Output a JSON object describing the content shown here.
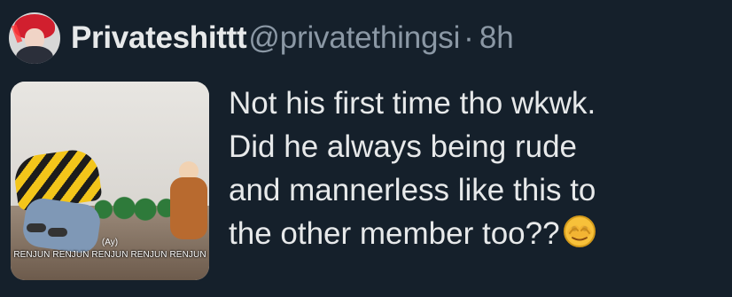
{
  "user": {
    "display_name": "Privateshittt",
    "handle": "@privatethingsi",
    "separator": "·",
    "time": "8h"
  },
  "media": {
    "caption_small": "(Ay)",
    "caption_main": "RENJUN RENJUN RENJUN RENJUN RENJUN"
  },
  "tweet": {
    "lines": [
      "Not his first time tho wkwk.",
      "Did he always being rude",
      "and mannerless like this to",
      "the other member too??"
    ],
    "emoji_name": "face-with-peeking-eye-emoji"
  },
  "colors": {
    "background": "#15202b",
    "text": "#e7e9ea",
    "secondary": "#8b98a5"
  }
}
